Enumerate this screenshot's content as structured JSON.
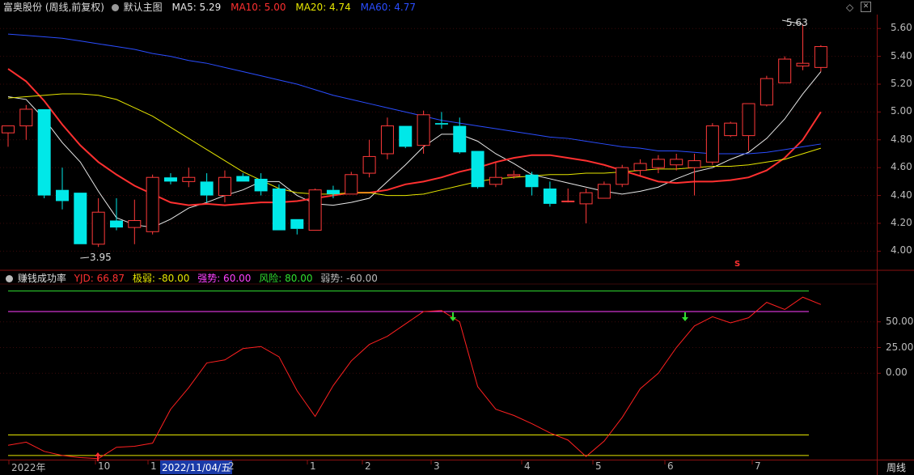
{
  "main_header": {
    "stock": "富奥股份 (周线,前复权)",
    "chart_name": "默认主图",
    "ma": [
      {
        "label": "MA5: 5.29",
        "color": "#e8e8e8"
      },
      {
        "label": "MA10: 5.00",
        "color": "#ff3030"
      },
      {
        "label": "MA20: 4.74",
        "color": "#e6e600"
      },
      {
        "label": "MA60: 4.77",
        "color": "#2a4dff"
      }
    ]
  },
  "indicator_header": {
    "name": "赚钱成功率",
    "items": [
      {
        "label": "YJD: 66.87",
        "color": "#ff3030"
      },
      {
        "label": "极弱: -80.00",
        "color": "#e6e600"
      },
      {
        "label": "强势: 60.00",
        "color": "#ff40ff"
      },
      {
        "label": "风险: 80.00",
        "color": "#30e030"
      },
      {
        "label": "弱势: -60.00",
        "color": "#bbbbbb"
      }
    ]
  },
  "price_axis": [
    "5.60",
    "5.40",
    "5.20",
    "5.00",
    "4.80",
    "4.60",
    "4.40",
    "4.20",
    "4.00"
  ],
  "indicator_axis": [
    "50.00",
    "25.00",
    "0.00"
  ],
  "markers": {
    "high": "5.63",
    "low": "3.95",
    "s_mark": "S"
  },
  "x_axis": [
    "2022年",
    "10",
    "1",
    "2022/11/04/五",
    "2",
    "1",
    "2",
    "3",
    "4",
    "5",
    "6",
    "7"
  ],
  "period_button": "周线",
  "chart_data": {
    "type": "candlestick",
    "ylim": [
      3.88,
      5.7
    ],
    "candles": [
      [
        4.85,
        4.9,
        4.75,
        4.9
      ],
      [
        4.9,
        5.05,
        4.8,
        5.02
      ],
      [
        5.02,
        5.02,
        4.38,
        4.4
      ],
      [
        4.44,
        4.6,
        4.3,
        4.36
      ],
      [
        4.42,
        4.42,
        4.05,
        4.05
      ],
      [
        4.05,
        4.38,
        4.03,
        4.28
      ],
      [
        4.22,
        4.38,
        4.15,
        4.17
      ],
      [
        4.17,
        4.37,
        4.05,
        4.22
      ],
      [
        4.14,
        4.55,
        4.12,
        4.53
      ],
      [
        4.53,
        4.56,
        4.48,
        4.5
      ],
      [
        4.5,
        4.6,
        4.46,
        4.53
      ],
      [
        4.5,
        4.56,
        4.35,
        4.4
      ],
      [
        4.4,
        4.58,
        4.35,
        4.53
      ],
      [
        4.54,
        4.56,
        4.5,
        4.5
      ],
      [
        4.52,
        4.56,
        4.4,
        4.43
      ],
      [
        4.45,
        4.48,
        4.15,
        4.15
      ],
      [
        4.23,
        4.23,
        4.12,
        4.16
      ],
      [
        4.15,
        4.45,
        4.15,
        4.44
      ],
      [
        4.44,
        4.47,
        4.38,
        4.41
      ],
      [
        4.41,
        4.57,
        4.41,
        4.55
      ],
      [
        4.56,
        4.8,
        4.53,
        4.68
      ],
      [
        4.7,
        4.96,
        4.66,
        4.9
      ],
      [
        4.9,
        4.9,
        4.74,
        4.75
      ],
      [
        4.76,
        5.01,
        4.7,
        4.98
      ],
      [
        4.92,
        5.0,
        4.88,
        4.91
      ],
      [
        4.9,
        4.96,
        4.7,
        4.71
      ],
      [
        4.72,
        4.72,
        4.45,
        4.46
      ],
      [
        4.48,
        4.64,
        4.46,
        4.53
      ],
      [
        4.54,
        4.58,
        4.52,
        4.55
      ],
      [
        4.55,
        4.57,
        4.4,
        4.46
      ],
      [
        4.45,
        4.5,
        4.32,
        4.34
      ],
      [
        4.36,
        4.45,
        4.35,
        4.36
      ],
      [
        4.34,
        4.45,
        4.2,
        4.42
      ],
      [
        4.38,
        4.5,
        4.38,
        4.48
      ],
      [
        4.48,
        4.62,
        4.46,
        4.6
      ],
      [
        4.58,
        4.66,
        4.54,
        4.63
      ],
      [
        4.6,
        4.69,
        4.56,
        4.66
      ],
      [
        4.62,
        4.7,
        4.58,
        4.66
      ],
      [
        4.6,
        4.7,
        4.4,
        4.65
      ],
      [
        4.64,
        4.92,
        4.62,
        4.9
      ],
      [
        4.83,
        4.93,
        4.82,
        4.92
      ],
      [
        4.83,
        5.05,
        4.72,
        5.06
      ],
      [
        5.05,
        5.26,
        5.04,
        5.24
      ],
      [
        5.21,
        5.4,
        5.21,
        5.38
      ],
      [
        5.33,
        5.63,
        5.3,
        5.35
      ],
      [
        5.32,
        5.48,
        5.29,
        5.47
      ]
    ],
    "ma_series": [
      {
        "name": "MA5",
        "color": "#e8e8e8",
        "values": [
          5.11,
          5.09,
          4.95,
          4.78,
          4.64,
          4.43,
          4.24,
          4.19,
          4.17,
          4.23,
          4.31,
          4.35,
          4.4,
          4.44,
          4.5,
          4.5,
          4.4,
          4.34,
          4.33,
          4.35,
          4.38,
          4.5,
          4.62,
          4.75,
          4.84,
          4.84,
          4.79,
          4.7,
          4.63,
          4.55,
          4.52,
          4.49,
          4.46,
          4.43,
          4.41,
          4.43,
          4.46,
          4.52,
          4.57,
          4.6,
          4.66,
          4.71,
          4.81,
          4.95,
          5.13,
          5.29
        ]
      },
      {
        "name": "MA10",
        "color": "#ff3030",
        "values": [
          5.31,
          5.22,
          5.08,
          4.91,
          4.76,
          4.64,
          4.55,
          4.47,
          4.41,
          4.35,
          4.33,
          4.34,
          4.33,
          4.34,
          4.35,
          4.35,
          4.36,
          4.38,
          4.4,
          4.42,
          4.42,
          4.44,
          4.48,
          4.5,
          4.53,
          4.57,
          4.6,
          4.64,
          4.67,
          4.69,
          4.69,
          4.67,
          4.65,
          4.62,
          4.58,
          4.54,
          4.5,
          4.49,
          4.5,
          4.5,
          4.51,
          4.53,
          4.58,
          4.67,
          4.8,
          5.0
        ]
      },
      {
        "name": "MA20",
        "color": "#e6e600",
        "values": [
          5.1,
          5.11,
          5.12,
          5.13,
          5.13,
          5.12,
          5.09,
          5.03,
          4.97,
          4.89,
          4.81,
          4.73,
          4.65,
          4.57,
          4.51,
          4.45,
          4.42,
          4.41,
          4.41,
          4.42,
          4.42,
          4.4,
          4.4,
          4.41,
          4.44,
          4.47,
          4.5,
          4.52,
          4.53,
          4.54,
          4.55,
          4.55,
          4.56,
          4.56,
          4.57,
          4.58,
          4.59,
          4.59,
          4.6,
          4.61,
          4.61,
          4.62,
          4.64,
          4.66,
          4.7,
          4.74
        ]
      },
      {
        "name": "MA60",
        "color": "#2a4dff",
        "values": [
          5.56,
          5.55,
          5.54,
          5.53,
          5.51,
          5.49,
          5.47,
          5.45,
          5.42,
          5.4,
          5.37,
          5.35,
          5.32,
          5.29,
          5.26,
          5.23,
          5.2,
          5.16,
          5.12,
          5.09,
          5.06,
          5.03,
          5.0,
          4.97,
          4.94,
          4.92,
          4.9,
          4.88,
          4.86,
          4.84,
          4.82,
          4.81,
          4.79,
          4.77,
          4.75,
          4.74,
          4.72,
          4.72,
          4.71,
          4.7,
          4.7,
          4.7,
          4.71,
          4.73,
          4.75,
          4.77
        ]
      }
    ],
    "indicator": {
      "ylim": [
        -84,
        86
      ],
      "yjd": [
        -70,
        -67,
        -76,
        -80,
        -82,
        -83,
        -72,
        -71,
        -68,
        -35,
        -14,
        10,
        13,
        24,
        26,
        16,
        -17,
        -42,
        -12,
        12,
        28,
        36,
        48,
        60,
        61,
        50,
        -13,
        -35,
        -41,
        -49,
        -58,
        -65,
        -81,
        -66,
        -43,
        -15,
        0,
        25,
        46,
        55,
        49,
        54,
        69,
        62,
        74,
        66.87
      ],
      "levels": [
        {
          "name": "风险",
          "value": 80,
          "color": "#30e030"
        },
        {
          "name": "强势",
          "value": 60,
          "color": "#ff40ff"
        },
        {
          "name": "弱势",
          "value": -60,
          "color": "#e6e600"
        },
        {
          "name": "极弱",
          "value": -80,
          "color": "#e6e600"
        }
      ]
    }
  }
}
